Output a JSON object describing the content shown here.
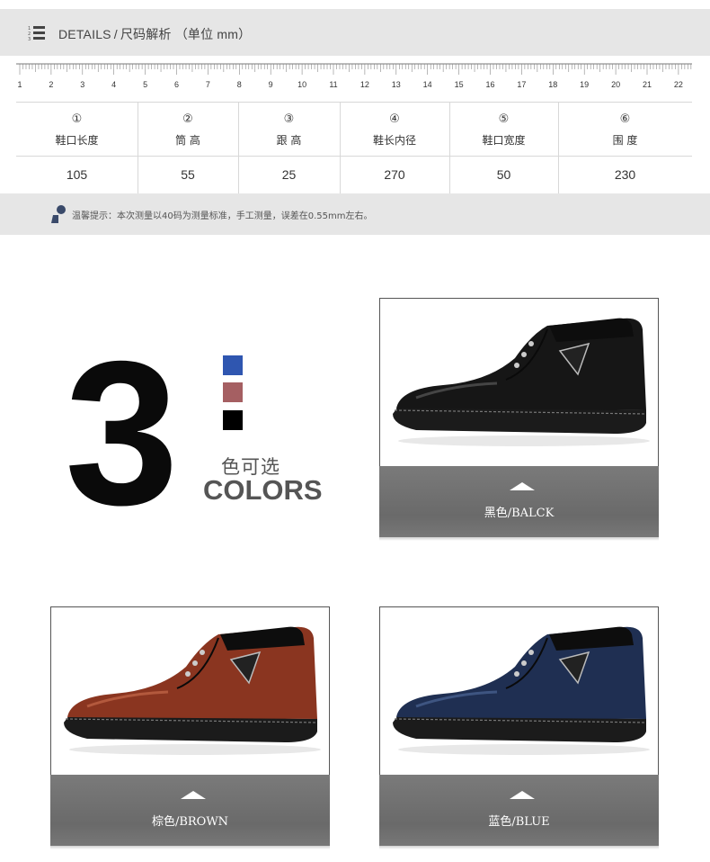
{
  "header": {
    "title_en": "DETAILS",
    "title_sep": "/",
    "title_cn": "尺码解析 （单位 mm）"
  },
  "ruler": {
    "numbers": [
      "1",
      "2",
      "3",
      "4",
      "5",
      "6",
      "7",
      "8",
      "9",
      "10",
      "11",
      "12",
      "13",
      "14",
      "15",
      "16",
      "17",
      "18",
      "19",
      "20",
      "21",
      "22"
    ]
  },
  "size_table": {
    "columns": [
      {
        "num": "①",
        "label": "鞋口长度",
        "value": "105"
      },
      {
        "num": "②",
        "label": "筒  高",
        "value": "55"
      },
      {
        "num": "③",
        "label": "跟  高",
        "value": "25"
      },
      {
        "num": "④",
        "label": "鞋长内径",
        "value": "270"
      },
      {
        "num": "⑤",
        "label": "鞋口宽度",
        "value": "50"
      },
      {
        "num": "⑥",
        "label": "围  度",
        "value": "230"
      }
    ]
  },
  "tip": {
    "text": "温馨提示：本次测量以40码为测量标准，手工测量，误差在0.55mm左右。"
  },
  "colors_block": {
    "big_number": "3",
    "cn": "色可选",
    "en": "COLORS",
    "swatches": [
      "#2f56b0",
      "#a55f62",
      "#000000"
    ]
  },
  "products": [
    {
      "label": "黑色/BALCK",
      "shoe_color": "#161616",
      "shoe_highlight": "#5a5a5a"
    },
    {
      "label": "棕色/BROWN",
      "shoe_color": "#8a3520",
      "shoe_highlight": "#c56a4a"
    },
    {
      "label": "蓝色/BLUE",
      "shoe_color": "#1f2f52",
      "shoe_highlight": "#4b6596"
    }
  ]
}
